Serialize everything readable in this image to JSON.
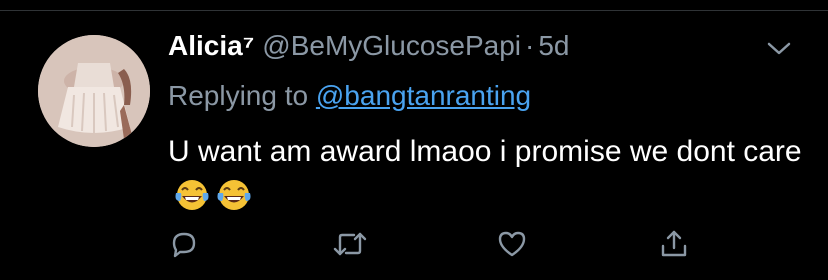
{
  "tweet": {
    "display_name": "Alicia⁷",
    "handle": "@BeMyGlucosePapi",
    "separator": "·",
    "time": "5d",
    "reply_prefix": "Replying to ",
    "reply_to": "@bangtanranting",
    "text": "U want am award lmaoo i promise we dont care",
    "emojis": [
      "face-with-tears-of-joy",
      "face-with-tears-of-joy"
    ]
  },
  "actions": {
    "icons": [
      "reply-icon",
      "retweet-icon",
      "like-icon",
      "share-icon"
    ]
  },
  "colors": {
    "background": "#000000",
    "primary_text": "#ffffff",
    "secondary_text": "#8b98a5",
    "link": "#4aa3f0"
  }
}
